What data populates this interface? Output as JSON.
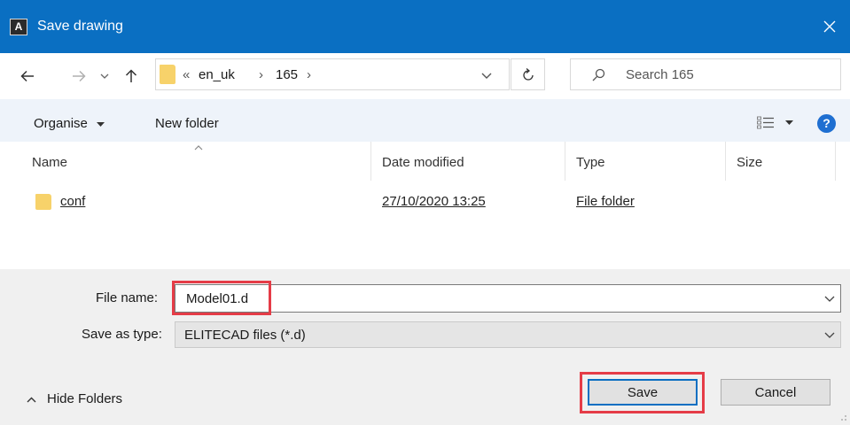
{
  "window": {
    "title": "Save drawing",
    "app_icon": "A",
    "accent_color": "#0a6fc2"
  },
  "nav": {
    "back_icon": "arrow-left",
    "forward_icon": "arrow-right",
    "recent_icon": "chevron-down",
    "up_icon": "arrow-up",
    "breadcrumb_overflow": "«",
    "breadcrumbs": [
      "en_uk",
      "165"
    ],
    "separator": "›",
    "refresh_icon": "refresh",
    "search_placeholder": "Search 165"
  },
  "toolbar": {
    "organise": "Organise",
    "new_folder": "New folder",
    "view_icon": "details-view",
    "help": "?"
  },
  "columns": {
    "name": "Name",
    "date_modified": "Date modified",
    "type": "Type",
    "size": "Size"
  },
  "files": [
    {
      "name": "conf",
      "date_modified": "27/10/2020 13:25",
      "type": "File folder",
      "size": ""
    }
  ],
  "form": {
    "file_name_label": "File name:",
    "file_name_value": "Model01.d",
    "save_as_type_label": "Save as type:",
    "save_as_type_value": "ELITECAD files (*.d)",
    "highlight_color": "#e53c47"
  },
  "footer": {
    "hide_folders": "Hide Folders",
    "save": "Save",
    "cancel": "Cancel"
  }
}
